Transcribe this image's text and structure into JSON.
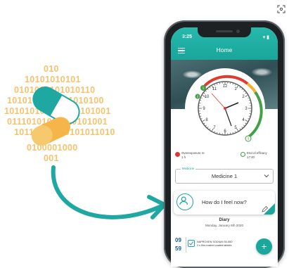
{
  "binary_lines": [
    "010",
    "10101010101",
    "0101010101010110",
    "1010101010101010100",
    "101010101010110101001",
    "01110101011010101001",
    "10110101010101011010",
    "0100001000",
    "001"
  ],
  "colors": {
    "accent": "#1aa79c",
    "pill": "#f5c26e",
    "arrow": "#1fa7a2",
    "dark_blue": "#195b8a"
  },
  "status": {
    "time": "3:25",
    "icons": "▾ ▮"
  },
  "app": {
    "title": "Home"
  },
  "clock": {
    "numerals": [
      "12",
      "1",
      "2",
      "3",
      "4",
      "5",
      "6",
      "7",
      "8",
      "9",
      "10",
      "11"
    ],
    "marker_labels": {
      "start": "1",
      "mid": "2",
      "end": "3"
    }
  },
  "legend": {
    "left": {
      "label": "Overexposure re",
      "value": "1 h"
    },
    "right": {
      "label": "End of efficacy",
      "value": "17:40"
    }
  },
  "medicine": {
    "field_label": "Medicine",
    "value": "Medicine 1"
  },
  "feel": {
    "question": "How do I feel now?"
  },
  "diary": {
    "title": "Diary",
    "date": "Monday, January 6th 2020",
    "entries": [
      {
        "hour": "09",
        "minute": "59",
        "drug_line1": "NAPROXEN SODIUM 50-550",
        "drug_line2": "2 x film-coated coated tablets"
      }
    ]
  },
  "fab": {
    "label": "+"
  },
  "icons": {
    "menu": "hamburger-icon",
    "scan": "scan-icon",
    "user": "user-icon",
    "edit": "pencil-icon",
    "chevron": "chevron-down-icon"
  }
}
